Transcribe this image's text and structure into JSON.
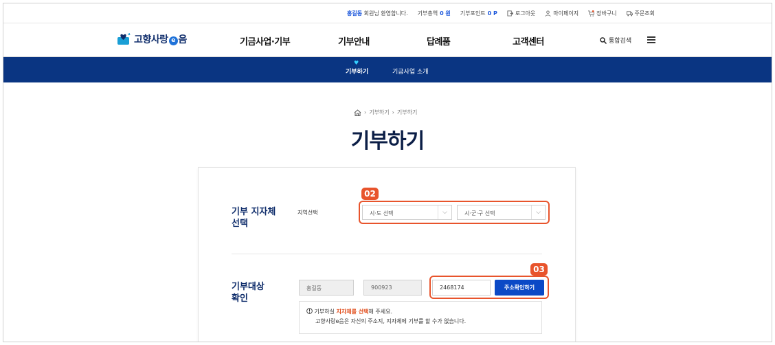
{
  "util_bar": {
    "user_name": "홍길동",
    "greeting": "회원님 환영합니다.",
    "donation_total_label": "기부총액",
    "donation_total_value": "0 원",
    "points_label": "기부포인트",
    "points_value": "0 P",
    "logout": "로그아웃",
    "mypage": "마이페이지",
    "cart": "장바구니",
    "order_lookup": "주문조회"
  },
  "header": {
    "logo_text_1": "고향사랑",
    "logo_e": "e",
    "logo_text_2": "음",
    "nav": [
      "기금사업·기부",
      "기부안내",
      "답례품",
      "고객센터"
    ],
    "search_label": "통합검색"
  },
  "subnav": {
    "tabs": [
      "기부하기",
      "기금사업 소개"
    ],
    "active": "기부하기"
  },
  "breadcrumb": [
    "기부하기",
    "기부하기"
  ],
  "page_title": "기부하기",
  "form": {
    "section1_title_line1": "기부 지자체",
    "section1_title_line2": "선택",
    "region_label": "지역선택",
    "province_select": "시·도 선택",
    "city_select": "시·군·구 선택",
    "section2_title_line1": "기부대상",
    "section2_title_line2": "확인",
    "name_value": "홍길동",
    "birth_value": "900923",
    "postal_value": "2468174",
    "address_button": "주소확인하기",
    "note_line1_pre": "기부하실 ",
    "note_line1_hl": "지자체를 선택",
    "note_line1_post": "해 주세요.",
    "note_line2": "고향사랑e음은 자신의 주소지, 지자체에 기부를 할 수가 없습니다."
  },
  "annotations": [
    "02",
    "03"
  ],
  "colors": {
    "brand_navy": "#0a3582",
    "accent_blue": "#1a56db",
    "highlight_red": "#e8542c"
  }
}
